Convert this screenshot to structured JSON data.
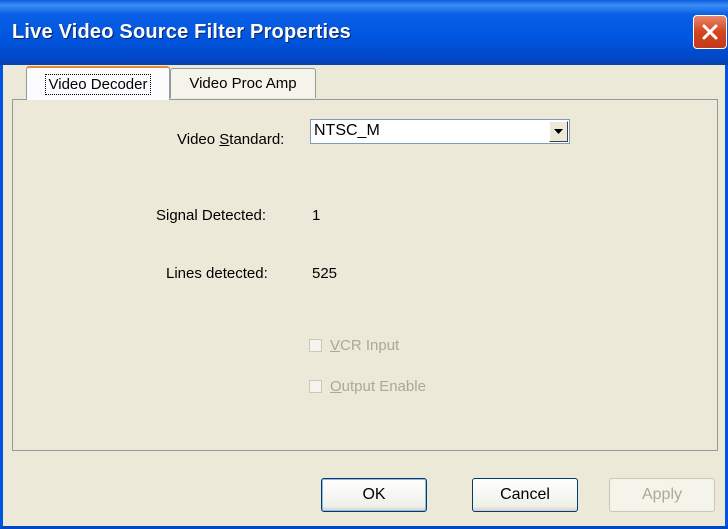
{
  "window": {
    "title": "Live Video Source Filter Properties"
  },
  "tabs": [
    {
      "label": "Video Decoder",
      "active": true
    },
    {
      "label": "Video Proc Amp",
      "active": false
    }
  ],
  "video_standard": {
    "label_prefix": "Video ",
    "label_mnemonic": "S",
    "label_suffix": "tandard:",
    "value": "NTSC_M"
  },
  "signal_detected": {
    "label": "Signal Detected:",
    "value": "1"
  },
  "lines_detected": {
    "label": "Lines detected:",
    "value": "525"
  },
  "checkboxes": [
    {
      "mnemonic": "V",
      "rest": "CR Input",
      "checked": false,
      "enabled": false
    },
    {
      "mnemonic": "O",
      "rest": "utput Enable",
      "checked": false,
      "enabled": false
    }
  ],
  "buttons": {
    "ok": "OK",
    "cancel": "Cancel",
    "apply": "Apply"
  },
  "icons": {
    "close": "close-icon",
    "dropdown": "chevron-down-icon"
  },
  "colors": {
    "titlebar": "#0055de",
    "tab_highlight": "#e68b2c",
    "face": "#ece9d8",
    "disabled_text": "#aca899"
  }
}
